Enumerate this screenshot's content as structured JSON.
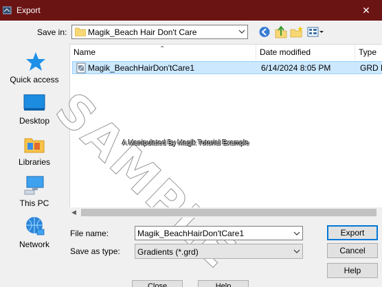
{
  "window": {
    "title": "Export",
    "close_glyph": "✕"
  },
  "toolbar": {
    "save_in_label": "Save in:",
    "save_in_value": "Magik_Beach Hair Don't Care",
    "icons": [
      "back-icon",
      "up-folder-icon",
      "new-folder-icon",
      "views-menu-icon"
    ]
  },
  "places": [
    {
      "label": "Quick access",
      "icon": "quick-access-star-icon"
    },
    {
      "label": "Desktop",
      "icon": "desktop-icon"
    },
    {
      "label": "Libraries",
      "icon": "libraries-icon"
    },
    {
      "label": "This PC",
      "icon": "this-pc-icon"
    },
    {
      "label": "Network",
      "icon": "network-icon"
    }
  ],
  "filelist": {
    "columns": [
      "Name",
      "Date modified",
      "Type"
    ],
    "rows": [
      {
        "name": "Magik_BeachHairDon'tCare1",
        "date": "6/14/2024 8:05 PM",
        "type": "GRD F",
        "selected": true
      }
    ]
  },
  "watermark": {
    "text": "SAMPLE",
    "caption": "A Manipulated By Magik Tutorial Example"
  },
  "form": {
    "file_name_label": "File name:",
    "file_name_value": "Magik_BeachHairDon'tCare1",
    "save_as_type_label": "Save as type:",
    "save_as_type_value": "Gradients (*.grd)"
  },
  "buttons": {
    "export": "Export",
    "cancel": "Cancel",
    "help": "Help"
  },
  "background_buttons": {
    "close": "Close",
    "help": "Help"
  },
  "colors": {
    "titlebar": "#6b1414",
    "selection": "#cce8ff",
    "accent": "#0078d7"
  }
}
